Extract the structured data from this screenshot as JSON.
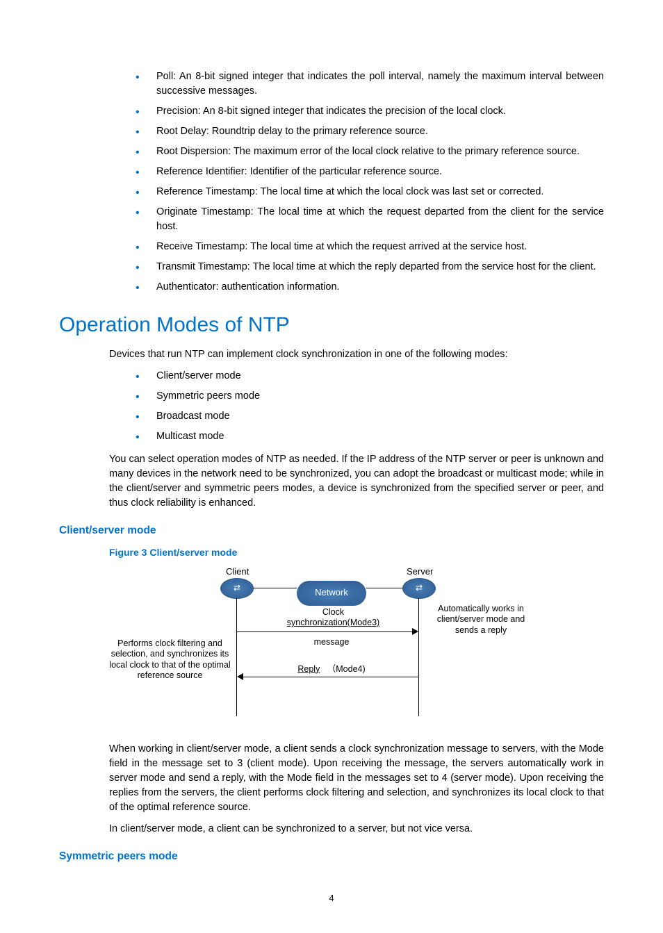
{
  "fields": [
    "Poll: An 8-bit signed integer that indicates the poll interval, namely the maximum interval between successive messages.",
    "Precision: An 8-bit signed integer that indicates the precision of the local clock.",
    "Root Delay: Roundtrip delay to the primary reference source.",
    "Root Dispersion: The maximum error of the local clock relative to the primary reference source.",
    "Reference Identifier: Identifier of the particular reference source.",
    "Reference Timestamp: The local time at which the local clock was last set or corrected.",
    "Originate Timestamp: The local time at which the request departed from the client for the service host.",
    "Receive Timestamp: The local time at which the request arrived at the service host.",
    "Transmit Timestamp: The local time at which the reply departed from the service host for the client.",
    "Authenticator: authentication information."
  ],
  "section": {
    "title": "Operation Modes of NTP",
    "intro": "Devices that run NTP can implement clock synchronization in one of the following modes:",
    "modes": [
      "Client/server mode",
      "Symmetric peers mode",
      "Broadcast mode",
      "Multicast mode"
    ],
    "para_select": "You can select operation modes of NTP as needed. If the IP address of the NTP server or peer is unknown and many devices in the network need to be synchronized, you can adopt the broadcast or multicast mode; while in the client/server and symmetric peers modes, a device is synchronized from the specified server or peer, and thus clock reliability is enhanced."
  },
  "cs": {
    "heading": "Client/server mode",
    "fig_caption": "Figure 3 Client/server mode",
    "diagram": {
      "client_label": "Client",
      "server_label": "Server",
      "network_label": "Network",
      "left_text": "Performs clock filtering and selection, and synchronizes its local clock to that of the optimal reference source",
      "right_text": "Automatically works in client/server mode and sends a reply",
      "sync_line1": "Clock",
      "sync_line2": "synchronization(Mode3)",
      "sync_msg": "message",
      "reply_label": "Reply",
      "reply_mode": "（Mode4)"
    },
    "para1": "When working in client/server mode, a client sends a clock synchronization message to servers, with the Mode field in the message set to 3 (client mode). Upon receiving the message, the servers automatically work in server mode and send a reply, with the Mode field in the messages set to 4 (server mode). Upon receiving the replies from the servers, the client performs clock filtering and selection, and synchronizes its local clock to that of the optimal reference source.",
    "para2": "In client/server mode, a client can be synchronized to a server, but not vice versa."
  },
  "sp": {
    "heading": "Symmetric peers mode"
  },
  "page_number": "4"
}
